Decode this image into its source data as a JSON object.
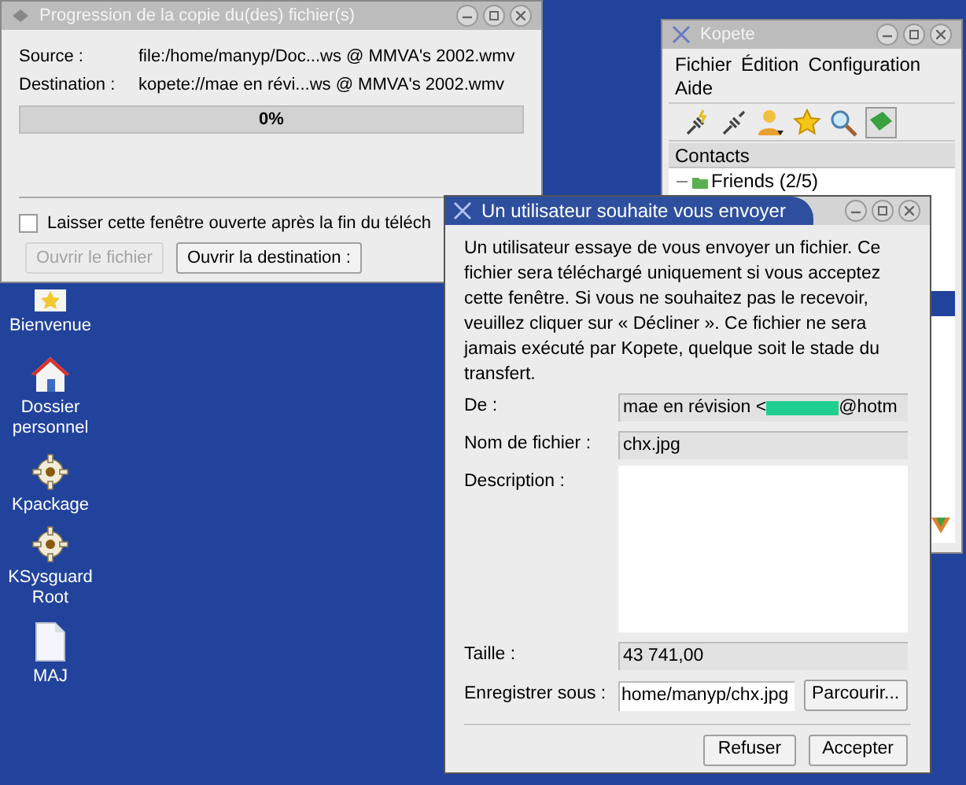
{
  "desktop_icons": [
    {
      "label": "Bienvenue",
      "kind": "star"
    },
    {
      "label": "Dossier personnel",
      "kind": "home"
    },
    {
      "label": "Kpackage",
      "kind": "gear"
    },
    {
      "label": "KSysguard Root",
      "kind": "gear"
    },
    {
      "label": "MAJ",
      "kind": "file"
    }
  ],
  "copy_window": {
    "title": "Progression de la copie du(des) fichier(s)",
    "source_label": "Source :",
    "source": "file:/home/manyp/Doc...ws @ MMVA's 2002.wmv",
    "destination_label": "Destination :",
    "destination": "kopete://mae en révi...ws @ MMVA's 2002.wmv",
    "progress": {
      "level": 0,
      "reading": "0%"
    },
    "keep_open": {
      "label": "Laisser cette fenêtre ouverte après la fin du téléch",
      "checked": false
    },
    "buttons": [
      {
        "label": "Ouvrir le fichier",
        "disabled": true
      },
      {
        "label": "Ouvrir la destination :",
        "disabled": false
      }
    ]
  },
  "kopete": {
    "title": "Kopete",
    "menu": [
      "Fichier",
      "Édition",
      "Configuration",
      "Aide"
    ],
    "contacts_header": "Contacts",
    "groups": [
      {
        "label": "Friends (2/5)",
        "expanded": true
      }
    ]
  },
  "dialog": {
    "title": "Un utilisateur souhaite vous envoyer",
    "message": "Un utilisateur essaye de vous envoyer un fichier. Ce fichier sera téléchargé uniquement si vous acceptez cette fenêtre. Si vous ne souhaitez pas le recevoir, veuillez cliquer sur « Décliner ». Ce fichier ne sera jamais exécuté par Kopete, quelque soit le stade du transfert.",
    "from_label": "De :",
    "from": "mae en révision <",
    "from_end": "@hotm",
    "redacted": true,
    "filename_label": "Nom de fichier :",
    "filename": "chx.jpg",
    "description_label": "Description :",
    "size_label": "Taille :",
    "size": "43 741,00",
    "save_label": "Enregistrer sous :",
    "save_path": "home/manyp/chx.jpg",
    "browse": "Parcourir...",
    "buttons": [
      "Refuser",
      "Accepter"
    ]
  }
}
